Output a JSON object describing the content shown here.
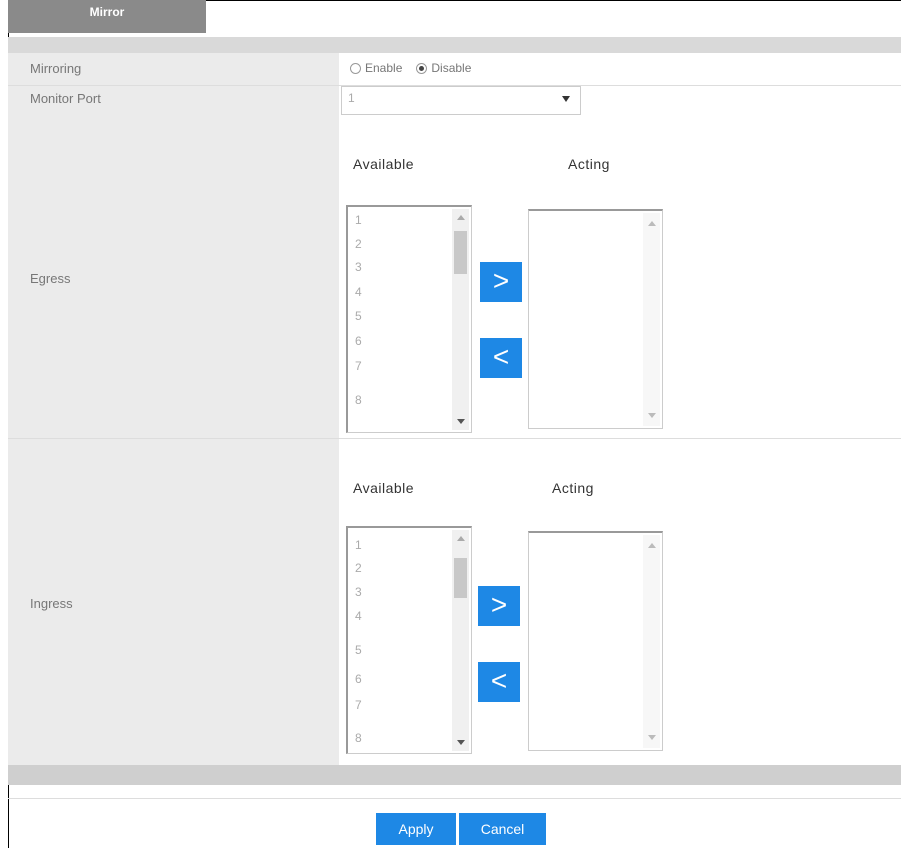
{
  "tab": {
    "label": "Mirror"
  },
  "mirroring": {
    "label": "Mirroring",
    "options": [
      "Enable",
      "Disable"
    ],
    "selected": "Disable"
  },
  "monitor_port": {
    "label": "Monitor Port",
    "value": "1"
  },
  "egress": {
    "label": "Egress",
    "available_header": "Available",
    "acting_header": "Acting",
    "available_items": [
      "1",
      "2",
      "3",
      "4",
      "5",
      "6",
      "7",
      "8"
    ]
  },
  "ingress": {
    "label": "Ingress",
    "available_header": "Available",
    "acting_header": "Acting",
    "available_items": [
      "1",
      "2",
      "3",
      "4",
      "5",
      "6",
      "7",
      "8"
    ]
  },
  "buttons": {
    "add": ">",
    "remove": "<",
    "apply": "Apply",
    "cancel": "Cancel"
  },
  "colors": {
    "accent": "#1e88e5",
    "tab_bg": "#8a8a8a",
    "label_col_bg": "#ebebeb"
  }
}
